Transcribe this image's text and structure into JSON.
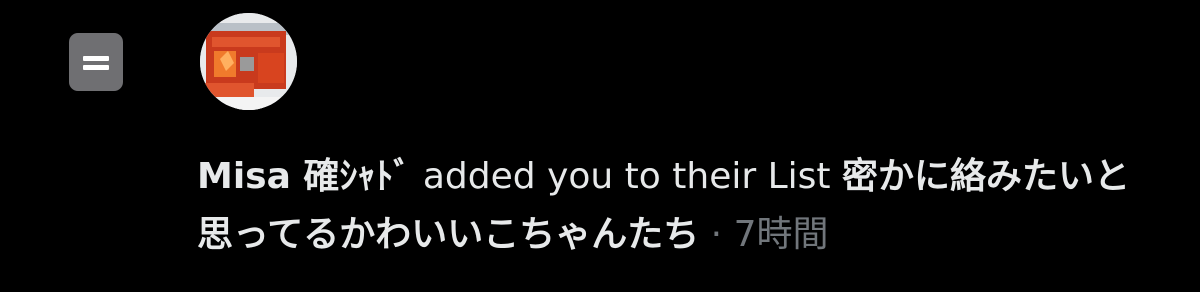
{
  "notification": {
    "icon": "list-icon",
    "avatar_icon": "user-avatar",
    "user_name": "Misa 確ｼｬﾄﾞ",
    "action_text": "added you to their List",
    "list_name": "密かに絡みたいと思ってるかわいいこちゃんたち",
    "separator": "·",
    "timestamp": "7時間"
  },
  "colors": {
    "background": "#000000",
    "primary_text": "#e7e9ea",
    "secondary_text": "#71767b",
    "list_icon_bg": "#6f6f72"
  }
}
